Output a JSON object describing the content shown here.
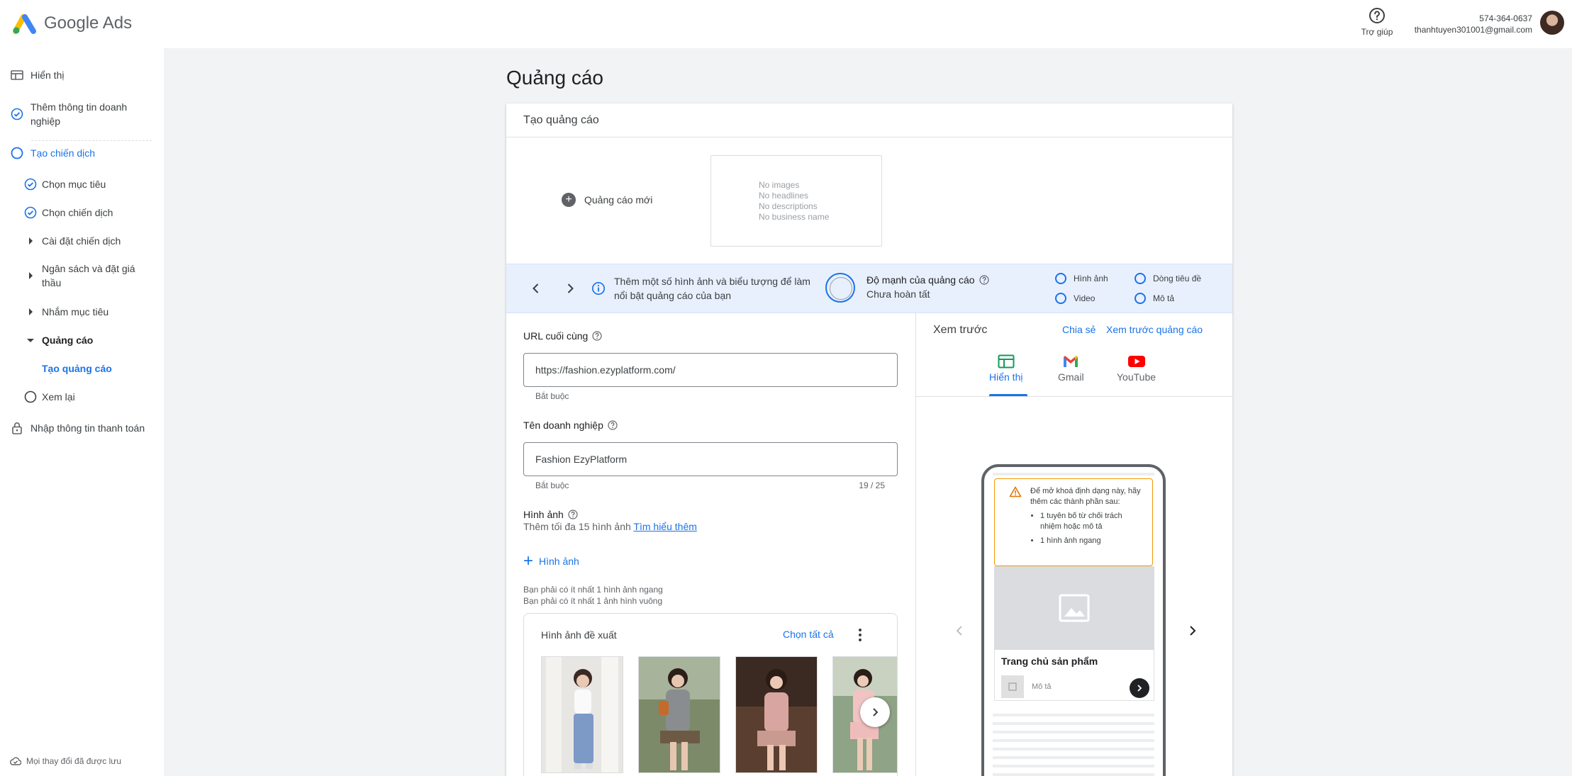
{
  "app": {
    "name": "Google Ads"
  },
  "header": {
    "help_label": "Trợ giúp",
    "phone": "574-364-0637",
    "email": "thanhtuyen301001@gmail.com",
    "logo_icon": "google-ads-logo",
    "help_icon": "help-circle-icon"
  },
  "sidebar": {
    "items": [
      {
        "label": "Hiển thị",
        "icon": "display-icon"
      },
      {
        "label": "Thêm thông tin doanh nghiệp",
        "icon": "check-circle-icon"
      },
      {
        "label": "Tạo chiến dịch",
        "icon": "circle-outline-icon"
      },
      {
        "label": "Chọn mục tiêu",
        "icon": "check-circle-icon"
      },
      {
        "label": "Chọn chiến dịch",
        "icon": "check-circle-icon"
      },
      {
        "label": "Cài đặt chiến dịch",
        "icon": "caret-right-icon"
      },
      {
        "label": "Ngân sách và đặt giá thầu",
        "icon": "caret-right-icon"
      },
      {
        "label": "Nhắm mục tiêu",
        "icon": "caret-right-icon"
      },
      {
        "label": "Quảng cáo",
        "icon": "caret-down-icon"
      },
      {
        "label": "Tạo quảng cáo",
        "icon": ""
      },
      {
        "label": "Xem lại",
        "icon": "circle-outline-icon"
      },
      {
        "label": "Nhập thông tin thanh toán",
        "icon": "lock-icon"
      }
    ],
    "saved_status": "Mọi thay đổi đã được lưu"
  },
  "main": {
    "page_title": "Quảng cáo",
    "card_title": "Tạo quảng cáo",
    "new_ad_label": "Quảng cáo mới",
    "thumb_lines": [
      "No images",
      "No headlines",
      "No descriptions",
      "No business name"
    ],
    "strength": {
      "tip": "Thêm một số hình ảnh và biểu tượng để làm nổi bật quảng cáo của bạn",
      "title": "Độ mạnh của quảng cáo",
      "status": "Chưa hoàn tất",
      "checks": [
        "Hình ảnh",
        "Dòng tiêu đề",
        "Video",
        "Mô tả"
      ]
    },
    "form": {
      "final_url_label": "URL cuối cùng",
      "final_url_value": "https://fashion.ezyplatform.com/",
      "required": "Bắt buộc",
      "business_name_label": "Tên doanh nghiệp",
      "business_name_value": "Fashion EzyPlatform",
      "business_name_counter": "19 / 25",
      "images_label": "Hình ảnh",
      "images_desc": "Thêm tối đa 15 hình ảnh",
      "learn_more": "Tìm hiểu thêm",
      "add_image": "Hình ảnh",
      "req_landscape": "Bạn phải có ít nhất 1 hình ảnh ngang",
      "req_square": "Bạn phải có ít nhất 1 ảnh hình vuông",
      "suggested_title": "Hình ảnh đề xuất",
      "select_all": "Chọn tất cả"
    },
    "preview": {
      "title": "Xem trước",
      "share": "Chia sẻ",
      "preview_ad": "Xem trước quảng cáo",
      "tabs": [
        "Hiển thị",
        "Gmail",
        "YouTube"
      ],
      "warning_text": "Để mở khoá định dạng này, hãy thêm các thành phần sau:",
      "warning_items": [
        "1 tuyên bố từ chối trách nhiệm hoặc mô tả",
        "1 hình ảnh ngang"
      ],
      "ad_title": "Trang chủ sản phẩm",
      "ad_desc": "Mô tả"
    }
  },
  "colors": {
    "accent": "#1a73e8",
    "warning": "#f29900",
    "strength_bg": "#e8f0fe"
  }
}
